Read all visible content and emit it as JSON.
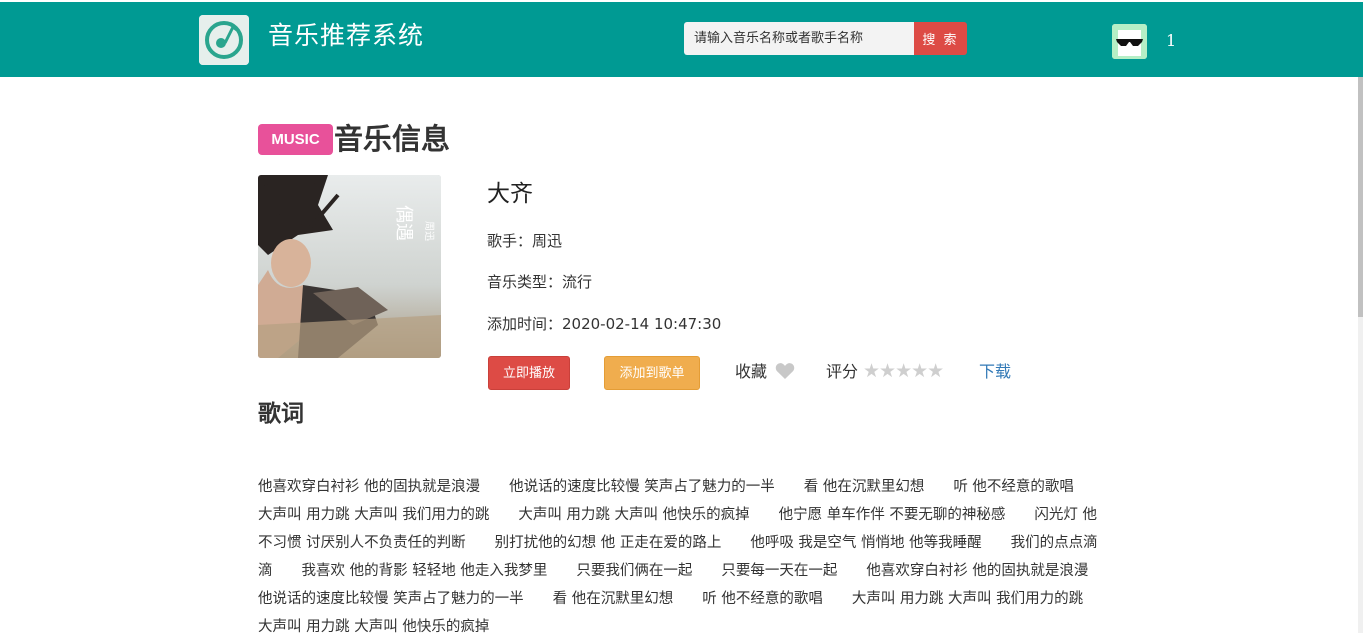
{
  "header": {
    "brand": "音乐推荐系统",
    "search_placeholder": "请输入音乐名称或者歌手名称",
    "search_button": "搜 索",
    "user_count": "1",
    "logo_icon": "music-disc-icon",
    "avatar_icon": "sunglasses-avatar-icon"
  },
  "section": {
    "badge": "MUSIC",
    "title": "音乐信息"
  },
  "song": {
    "title": "大齐",
    "singer_line": "歌手：周迅",
    "genre_line": "音乐类型：流行",
    "added_line": "添加时间：2020-02-14 10:47:30",
    "cover_text": "偶遇 周迅"
  },
  "actions": {
    "play": "立即播放",
    "add_to_playlist": "添加到歌单",
    "favorite": "收藏",
    "rating_label": "评分",
    "stars": "★★★★★",
    "rating_value": 0,
    "download": "下载"
  },
  "lyrics": {
    "heading": "歌词",
    "text": "他喜欢穿白衬衫 他的固执就是浪漫　　他说话的速度比较慢 笑声占了魅力的一半　　看 他在沉默里幻想　　听 他不经意的歌唱　　大声叫 用力跳 大声叫 我们用力的跳　　大声叫 用力跳 大声叫 他快乐的疯掉　　他宁愿 单车作伴 不要无聊的神秘感　　闪光灯 他不习惯 讨厌别人不负责任的判断　　别打扰他的幻想 他 正走在爱的路上　　他呼吸 我是空气 悄悄地 他等我睡醒　　我们的点点滴滴　　我喜欢 他的背影 轻轻地 他走入我梦里　　只要我们俩在一起　　只要每一天在一起　　他喜欢穿白衬衫 他的固执就是浪漫　　他说话的速度比较慢 笑声占了魅力的一半　　看 他在沉默里幻想　　听 他不经意的歌唱　　大声叫 用力跳 大声叫 我们用力的跳　　大声叫 用力跳 大声叫 他快乐的疯掉"
  },
  "colors": {
    "navbar": "#009a93",
    "badge": "#e8519a",
    "play_button": "#dd4b45",
    "add_button": "#f0ad4e",
    "link": "#337ab7"
  }
}
